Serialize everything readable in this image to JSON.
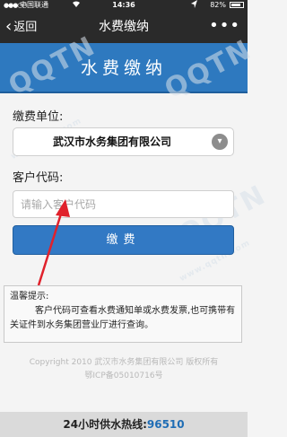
{
  "status_bar": {
    "signal": "●●●○○",
    "carrier": "中国联通",
    "time": "14:36",
    "battery": "82%"
  },
  "nav": {
    "back_label": "返回",
    "title": "水费缴纳",
    "more_label": "•••"
  },
  "header": {
    "title": "水费缴纳"
  },
  "form": {
    "unit_label": "缴费单位:",
    "unit_value": "武汉市水务集团有限公司",
    "code_label": "客户代码:",
    "code_placeholder": "请输入客户代码",
    "code_value": "",
    "pay_button": "缴费"
  },
  "tips": {
    "title": "温馨提示:",
    "text": "客户代码可查看水费通知单或水费发票,也可携带有关证件到水务集团营业厅进行查询。"
  },
  "copyright": {
    "line1": "Copyright 2010 武汉市水务集团有限公司 版权所有",
    "line2": "鄂ICP备05010716号"
  },
  "footer": {
    "label": "24小时供水热线:",
    "phone": "96510"
  },
  "watermark": {
    "text": "QQTN",
    "site": "www.qqtn.com"
  },
  "colors": {
    "nav_bg": "#2a2a2a",
    "header_blue": "#2e79bf",
    "button_blue": "#3279c4",
    "hotline_blue": "#1f6db5",
    "annotation_red": "#e0212b"
  }
}
